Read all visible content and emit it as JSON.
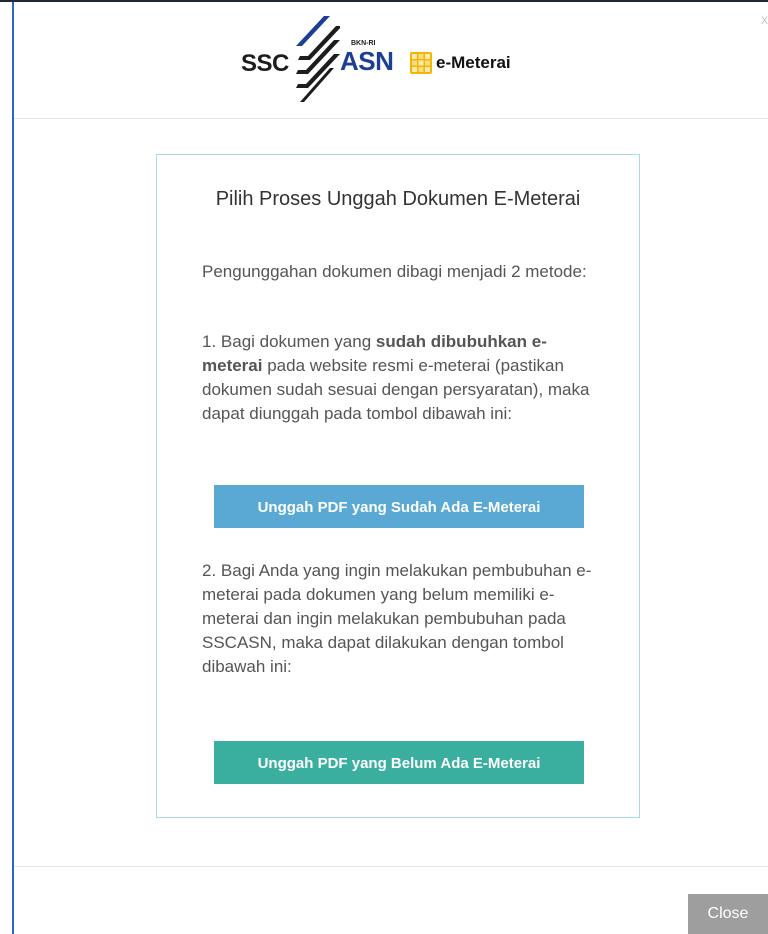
{
  "header": {
    "logo_ssc": "SSC",
    "logo_asn": "ASN",
    "logo_bkn": "BKN-RI",
    "emeterai": "e-Meterai",
    "close_symbol": "x"
  },
  "panel": {
    "title": "Pilih Proses Unggah Dokumen E-Meterai",
    "intro": "Pengunggahan dokumen dibagi menjadi 2 metode:",
    "step1_prefix": "1. Bagi dokumen yang ",
    "step1_bold": "sudah dibubuhkan e-meterai",
    "step1_suffix": " pada website resmi e-meterai (pastikan dokumen sudah sesuai dengan persyaratan), maka dapat diunggah pada tombol dibawah ini:",
    "button1": "Unggah PDF yang Sudah Ada E-Meterai",
    "step2": "2. Bagi Anda yang ingin melakukan pembubuhan e-meterai pada dokumen yang belum memiliki e-meterai dan ingin melakukan pembubuhan pada SSCASN, maka dapat dilakukan dengan tombol dibawah ini:",
    "button2": "Unggah PDF yang Belum Ada E-Meterai"
  },
  "footer": {
    "close_label": "Close"
  },
  "colors": {
    "button_blue": "#5aa9d5",
    "button_teal": "#3aaf9f",
    "close_gray": "#9e9e9e",
    "panel_border": "#a9dbe6"
  }
}
